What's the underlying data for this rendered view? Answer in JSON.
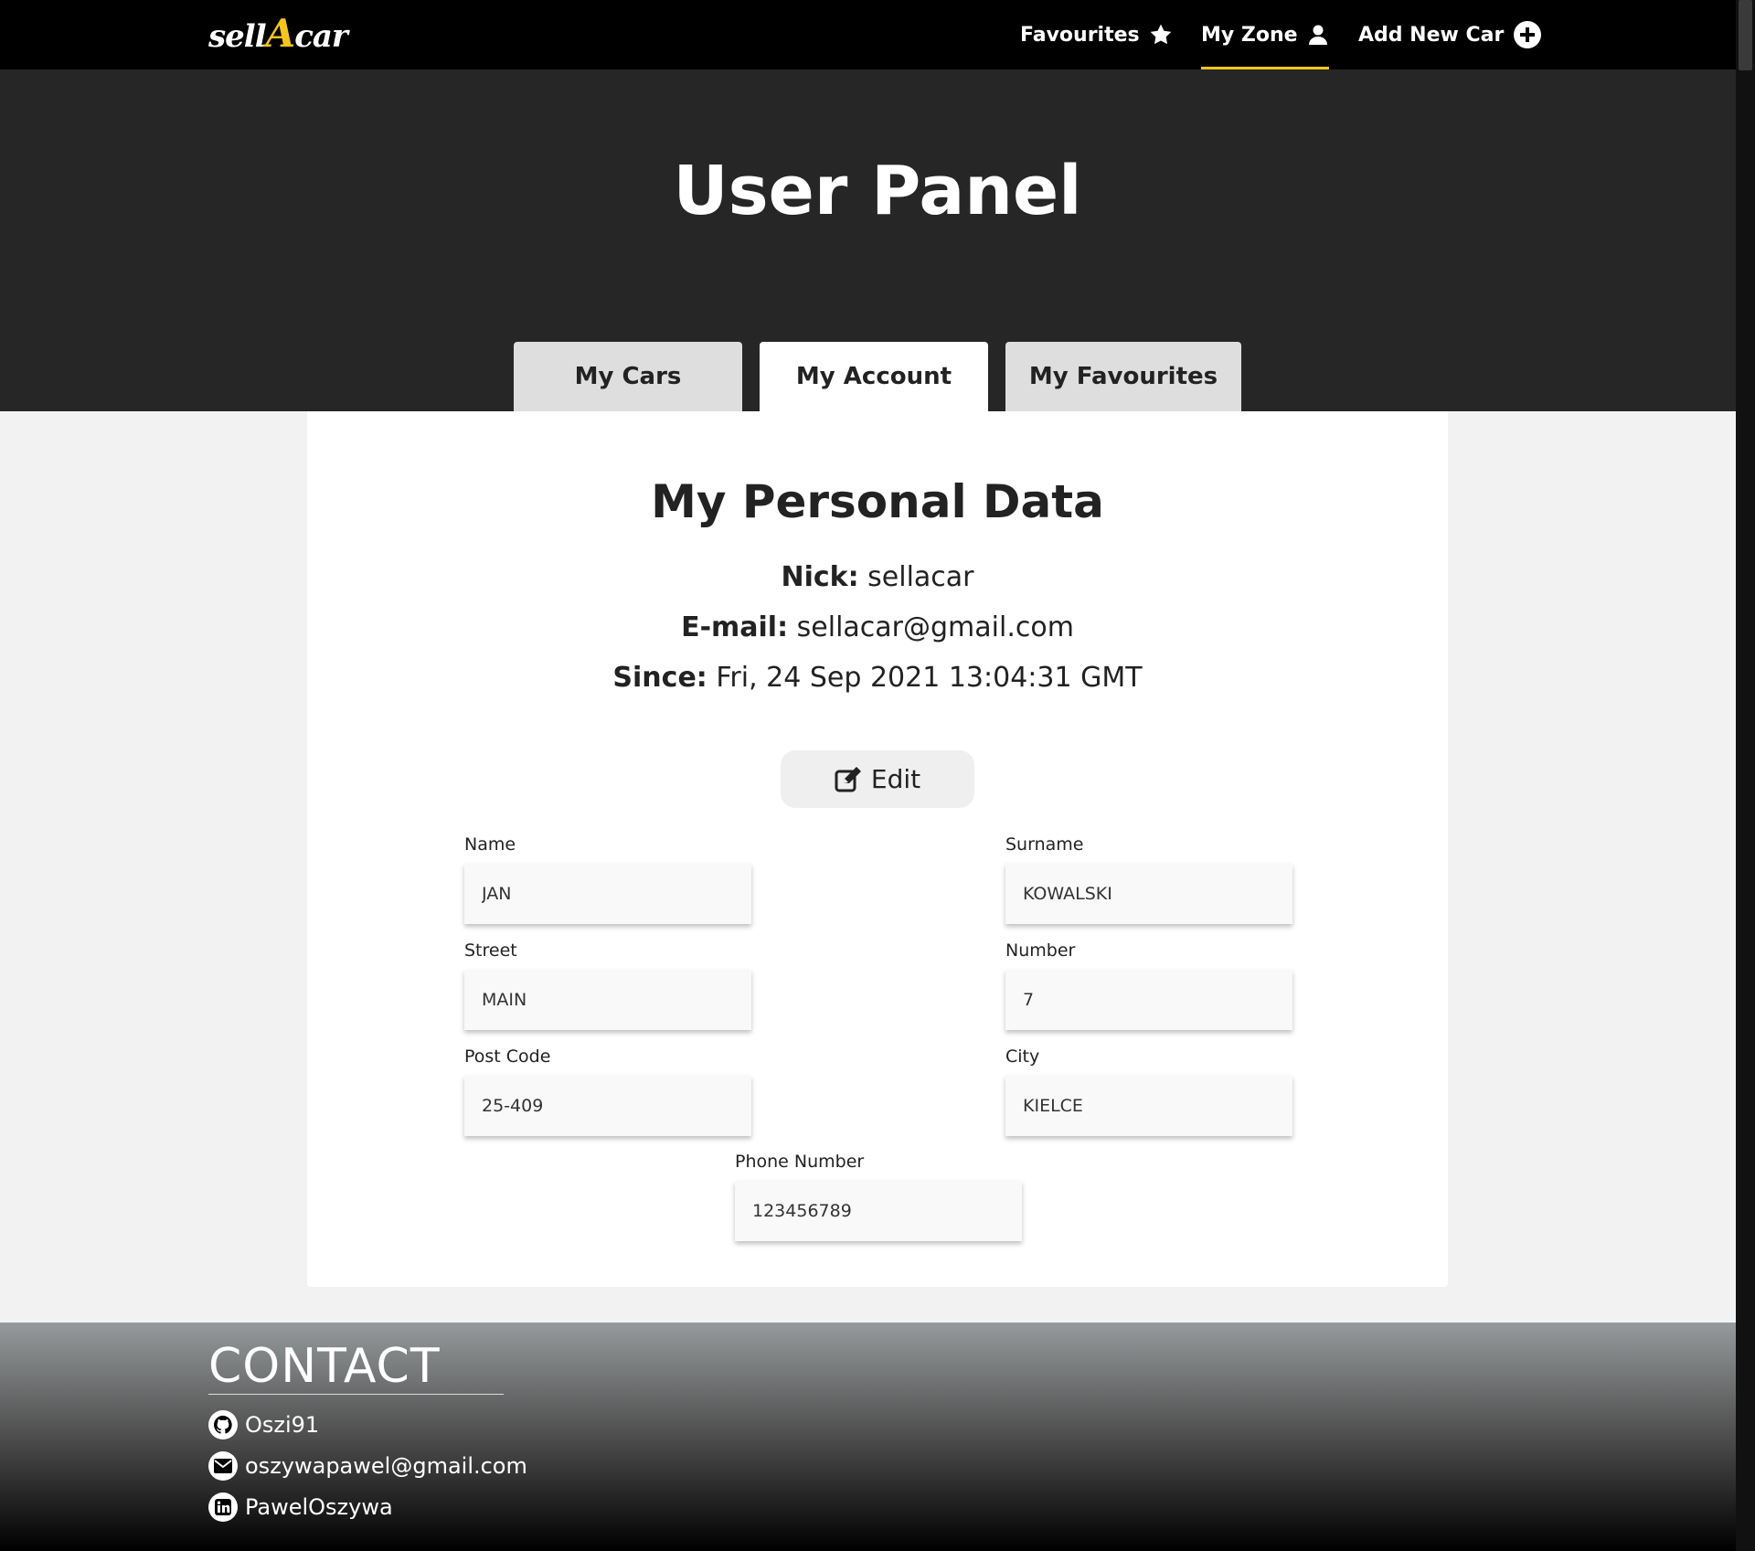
{
  "nav": {
    "logo_part1": "sell",
    "logo_part2": "A",
    "logo_part3": "car",
    "favourites": "Favourites",
    "my_zone": "My Zone",
    "add_new_car": "Add New Car"
  },
  "hero": {
    "title": "User Panel",
    "tabs": {
      "cars": "My Cars",
      "account": "My Account",
      "favourites": "My Favourites"
    }
  },
  "account": {
    "title": "My Personal Data",
    "nick_label": "Nick:",
    "nick": "sellacar",
    "email_label": "E-mail:",
    "email": "sellacar@gmail.com",
    "since_label": "Since:",
    "since": "Fri, 24 Sep 2021 13:04:31 GMT",
    "edit_label": "Edit"
  },
  "form": {
    "name": {
      "label": "Name",
      "value": "JAN"
    },
    "surname": {
      "label": "Surname",
      "value": "KOWALSKI"
    },
    "street": {
      "label": "Street",
      "value": "MAIN"
    },
    "number": {
      "label": "Number",
      "value": "7"
    },
    "post_code": {
      "label": "Post Code",
      "value": "25-409"
    },
    "city": {
      "label": "City",
      "value": "KIELCE"
    },
    "phone": {
      "label": "Phone Number",
      "value": "123456789"
    }
  },
  "footer": {
    "title": "CONTACT",
    "github": "Oszi91",
    "email": "oszywapawel@gmail.com",
    "linkedin": "PawelOszywa"
  },
  "colors": {
    "accent": "#f5c518",
    "navbar": "#000000",
    "hero": "#262626"
  }
}
